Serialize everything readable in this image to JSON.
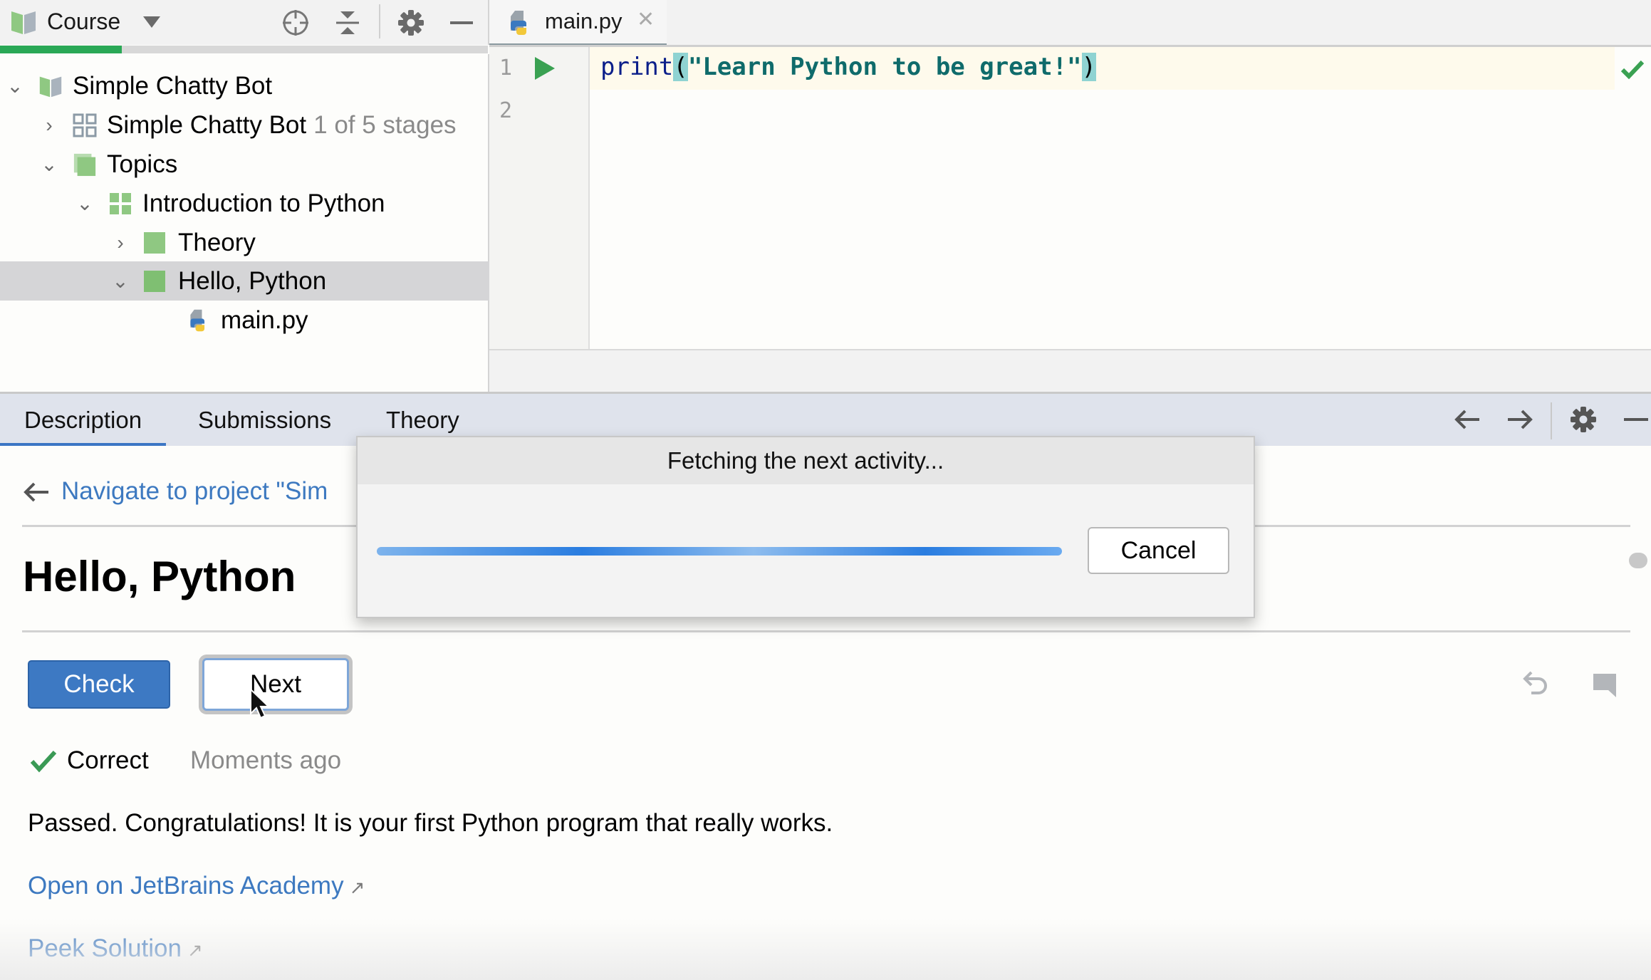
{
  "project_panel": {
    "title": "Course",
    "toolbar_icons": [
      "locate-icon",
      "collapse-all-icon",
      "gear-icon",
      "minimize-icon"
    ],
    "course_progress": 0.25,
    "tree": [
      {
        "label": "Simple Chatty Bot",
        "suffix": "",
        "icon": "course-book-icon",
        "expanded": true,
        "level": 0
      },
      {
        "label": "Simple Chatty Bot",
        "suffix": "1 of 5 stages",
        "icon": "project-grid-icon",
        "expanded": false,
        "level": 1
      },
      {
        "label": "Topics",
        "suffix": "",
        "icon": "section-icon",
        "expanded": true,
        "level": 1
      },
      {
        "label": "Introduction to Python",
        "suffix": "",
        "icon": "lesson-grid-icon",
        "expanded": true,
        "level": 2
      },
      {
        "label": "Theory",
        "suffix": "",
        "icon": "task-icon",
        "expanded": false,
        "level": 3
      },
      {
        "label": "Hello, Python",
        "suffix": "",
        "icon": "task-icon",
        "expanded": true,
        "level": 3,
        "selected": true
      },
      {
        "label": "main.py",
        "suffix": "",
        "icon": "python-file-icon",
        "level": 4
      }
    ]
  },
  "editor": {
    "tab_label": "main.py",
    "line_numbers": [
      "1",
      "2"
    ],
    "code": {
      "func": "print",
      "open": "(",
      "string": "\"Learn Python to be great!\"",
      "close": ")"
    },
    "status_icon": "check-icon"
  },
  "tool_window": {
    "tabs": [
      {
        "label": "Description",
        "active": true
      },
      {
        "label": "Submissions",
        "active": false
      },
      {
        "label": "Theory",
        "active": false
      }
    ],
    "nav_link": "Navigate to project \"Sim",
    "task_title": "Hello, Python",
    "check_label": "Check",
    "next_label": "Next",
    "result_status": "Correct",
    "result_time": "Moments ago",
    "message": "Passed. Congratulations! It is your first Python program that really works.",
    "open_link": "Open on JetBrains Academy",
    "peek_link": "Peek Solution"
  },
  "dialog": {
    "title": "Fetching the next activity...",
    "progress": 1.0,
    "cancel_label": "Cancel"
  },
  "colors": {
    "accent_blue": "#3d79c3",
    "success_green": "#2aa856",
    "link": "#3d79c0"
  }
}
